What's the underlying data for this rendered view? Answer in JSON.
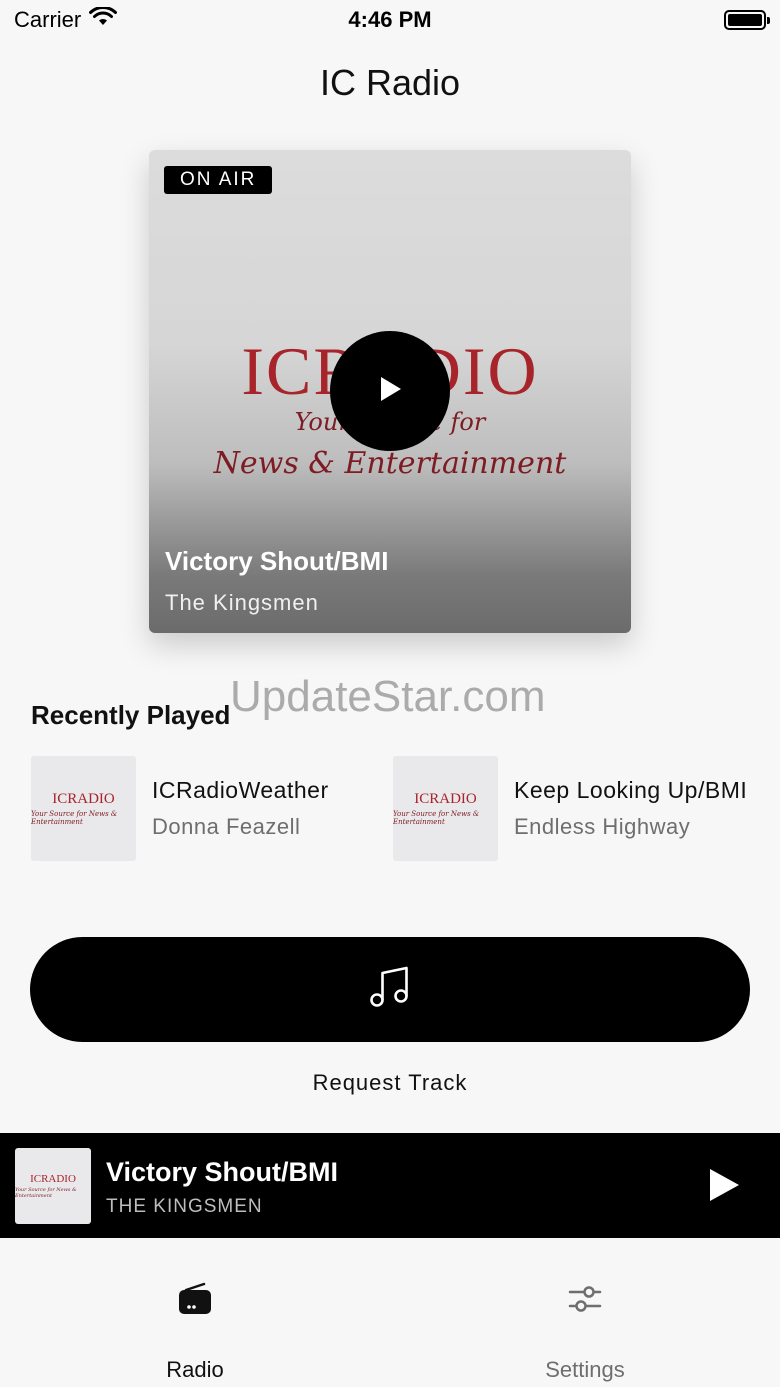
{
  "status_bar": {
    "carrier": "Carrier",
    "time": "4:46 PM"
  },
  "nav": {
    "title": "IC Radio"
  },
  "now_playing_card": {
    "badge": "ON AIR",
    "logo_title": "ICRADIO",
    "logo_line1": "Your Source for",
    "logo_line2": "News & Entertainment",
    "track_title": "Victory Shout/BMI",
    "artist": "The Kingsmen"
  },
  "watermark": "UpdateStar.com",
  "recently_played": {
    "heading": "Recently Played",
    "items": [
      {
        "title": "ICRadioWeather",
        "artist": "Donna Feazell",
        "thumb_logo": "ICRADIO",
        "thumb_sub": "Your Source for News & Entertainment"
      },
      {
        "title": "Keep Looking Up/BMI",
        "artist": "Endless Highway",
        "thumb_logo": "ICRADIO",
        "thumb_sub": "Your Source for News & Entertainment"
      }
    ]
  },
  "request": {
    "label": "Request Track",
    "icon": "music-note-icon"
  },
  "mini_player": {
    "title": "Victory Shout/BMI",
    "artist": "THE KINGSMEN",
    "thumb_logo": "ICRADIO",
    "thumb_sub": "Your Source for News & Entertainment"
  },
  "tabs": [
    {
      "label": "Radio",
      "icon": "radio-icon",
      "active": true,
      "color": "#111111"
    },
    {
      "label": "Settings",
      "icon": "sliders-icon",
      "active": false,
      "color": "#6e6e6e"
    }
  ]
}
